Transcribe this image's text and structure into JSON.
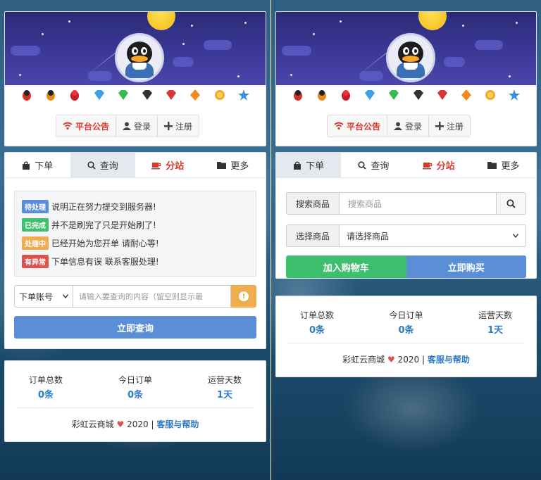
{
  "left": {
    "header": {
      "gems": [
        "penguin-red-icon",
        "penguin-orange-icon",
        "penguin-crimson-icon",
        "diamond-blue-icon",
        "diamond-green-icon",
        "diamond-black-icon",
        "diamond-red-icon",
        "diamond-orange-icon",
        "coin-icon",
        "star-icon"
      ],
      "buttons": {
        "notice": "平台公告",
        "login": "登录",
        "register": "注册"
      }
    },
    "tabs": {
      "order": "下单",
      "query": "查询",
      "branch": "分站",
      "more": "更多"
    },
    "status_rows": [
      {
        "badge": "待处理",
        "color": "#5a8fd8",
        "text": "说明正在努力提交到服务器!"
      },
      {
        "badge": "已完成",
        "color": "#3dbf6d",
        "text": "并不是刷完了只是开始刷了!"
      },
      {
        "badge": "处理中",
        "color": "#f0ad4e",
        "text": "已经开始为您开单 请耐心等!"
      },
      {
        "badge": "有异常",
        "color": "#d9534f",
        "text": "下单信息有误 联系客服处理!"
      }
    ],
    "query": {
      "select": "下单账号",
      "placeholder": "请输入要查询的内容（留空则显示最",
      "button": "立即查询"
    },
    "stats": [
      {
        "label": "订单总数",
        "value": "0条"
      },
      {
        "label": "今日订单",
        "value": "0条"
      },
      {
        "label": "运营天数",
        "value": "1天"
      }
    ],
    "footer": {
      "brand": "彩虹云商城",
      "year": "2020 |",
      "link": "客服与帮助"
    }
  },
  "right": {
    "header": {
      "buttons": {
        "notice": "平台公告",
        "login": "登录",
        "register": "注册"
      }
    },
    "tabs": {
      "order": "下单",
      "query": "查询",
      "branch": "分站",
      "more": "更多"
    },
    "search": {
      "label": "搜索商品",
      "placeholder": "搜索商品"
    },
    "select": {
      "label": "选择商品",
      "value": "请选择商品"
    },
    "buttons": {
      "cart": "加入购物车",
      "buy": "立即购买"
    },
    "stats": [
      {
        "label": "订单总数",
        "value": "0条"
      },
      {
        "label": "今日订单",
        "value": "0条"
      },
      {
        "label": "运营天数",
        "value": "1天"
      }
    ],
    "footer": {
      "brand": "彩虹云商城",
      "year": "2020 |",
      "link": "客服与帮助"
    }
  }
}
